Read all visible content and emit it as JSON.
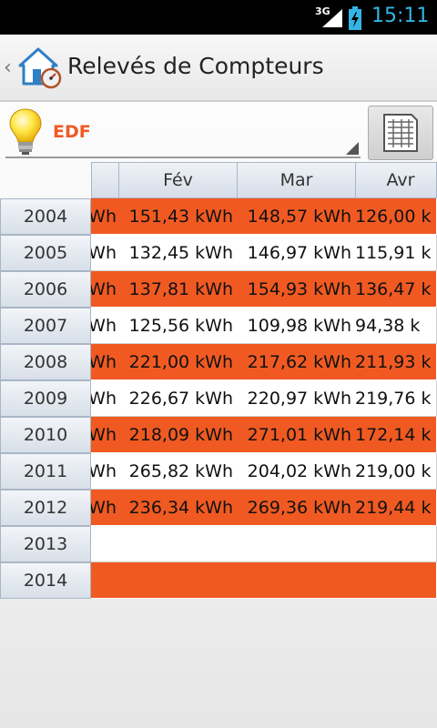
{
  "status_bar": {
    "network": "3G",
    "time": "15:11"
  },
  "action_bar": {
    "title": "Relevés de Compteurs"
  },
  "meter_selector": {
    "selected": "EDF"
  },
  "colors": {
    "accent": "#f05a22",
    "status_time": "#33b5e5"
  },
  "table": {
    "columns": [
      "",
      "Fév",
      "Mar",
      "Avr"
    ],
    "rows": [
      {
        "year": "2004",
        "cells": [
          "Wh",
          "151,43 kWh",
          "148,57 kWh",
          "126,00 k"
        ]
      },
      {
        "year": "2005",
        "cells": [
          "Wh",
          "132,45 kWh",
          "146,97 kWh",
          "115,91 k"
        ]
      },
      {
        "year": "2006",
        "cells": [
          "Wh",
          "137,81 kWh",
          "154,93 kWh",
          "136,47 k"
        ]
      },
      {
        "year": "2007",
        "cells": [
          "Wh",
          "125,56 kWh",
          "109,98 kWh",
          "94,38 k"
        ]
      },
      {
        "year": "2008",
        "cells": [
          "Wh",
          "221,00 kWh",
          "217,62 kWh",
          "211,93 k"
        ]
      },
      {
        "year": "2009",
        "cells": [
          "Wh",
          "226,67 kWh",
          "220,97 kWh",
          "219,76 k"
        ]
      },
      {
        "year": "2010",
        "cells": [
          "Wh",
          "218,09 kWh",
          "271,01 kWh",
          "172,14 k"
        ]
      },
      {
        "year": "2011",
        "cells": [
          "Wh",
          "265,82 kWh",
          "204,02 kWh",
          "219,00 k"
        ]
      },
      {
        "year": "2012",
        "cells": [
          "Wh",
          "236,34 kWh",
          "269,36 kWh",
          "219,44 k"
        ]
      },
      {
        "year": "2013",
        "cells": [
          "",
          "",
          "",
          ""
        ]
      },
      {
        "year": "2014",
        "cells": [
          "",
          "",
          "",
          ""
        ]
      }
    ]
  }
}
